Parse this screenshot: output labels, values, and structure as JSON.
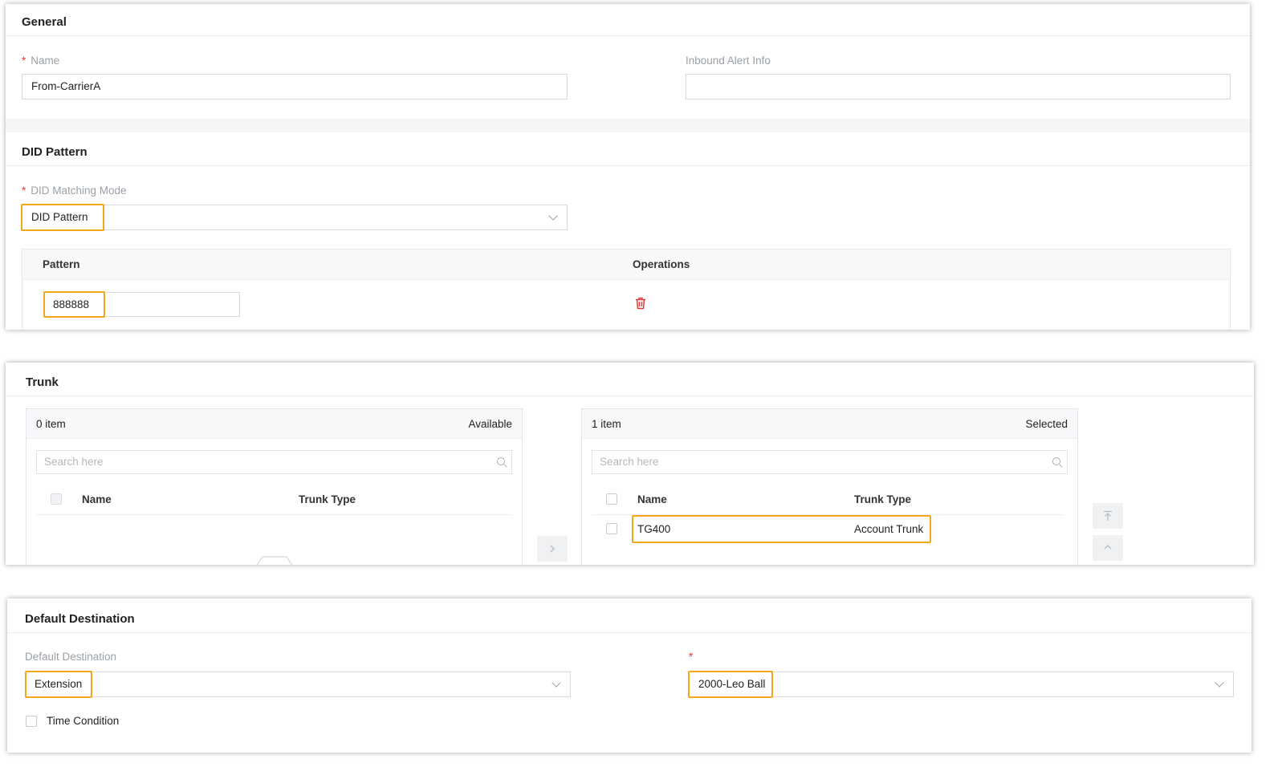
{
  "general": {
    "title": "General",
    "name_label": "Name",
    "name_value": "From-CarrierA",
    "inbound_alert_label": "Inbound Alert Info",
    "inbound_alert_value": ""
  },
  "did": {
    "title": "DID Pattern",
    "matching_mode_label": "DID Matching Mode",
    "matching_mode_value": "DID Pattern",
    "table_headers": [
      "Pattern",
      "Operations"
    ],
    "rows": [
      {
        "pattern": "888888"
      }
    ]
  },
  "trunk": {
    "title": "Trunk",
    "available": {
      "count": "0 item",
      "label": "Available",
      "search_placeholder": "Search here",
      "columns": [
        "Name",
        "Trunk Type"
      ]
    },
    "selected": {
      "count": "1 item",
      "label": "Selected",
      "search_placeholder": "Search here",
      "columns": [
        "Name",
        "Trunk Type"
      ],
      "rows": [
        {
          "name": "TG400",
          "type": "Account Trunk"
        }
      ]
    }
  },
  "default_destination": {
    "title": "Default Destination",
    "label": "Default Destination",
    "type_value": "Extension",
    "target_value": "2000-Leo Ball",
    "time_condition_label": "Time Condition"
  },
  "colors": {
    "highlight": "#f2a81b",
    "required": "#e23b3b",
    "delete_icon": "#e23b3b"
  },
  "icons": [
    "chevron-down-icon",
    "trash-icon",
    "search-icon",
    "arrow-right-icon",
    "move-top-icon",
    "move-up-icon"
  ]
}
